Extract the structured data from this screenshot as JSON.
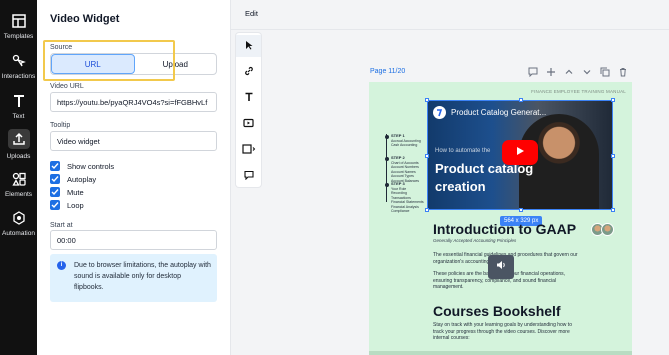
{
  "rail": {
    "items": [
      {
        "label": "Templates",
        "icon": "templates-icon"
      },
      {
        "label": "Interactions",
        "icon": "interactions-icon"
      },
      {
        "label": "Text",
        "icon": "text-icon"
      },
      {
        "label": "Uploads",
        "icon": "upload-icon"
      },
      {
        "label": "Elements",
        "icon": "elements-icon"
      },
      {
        "label": "Automation",
        "icon": "automation-icon"
      }
    ]
  },
  "panel": {
    "title": "Video Widget",
    "source_label": "Source",
    "source_options": [
      "URL",
      "Upload"
    ],
    "source_selected": "URL",
    "video_url_label": "Video URL",
    "video_url_value": "https://youtu.be/pyaQRJ4VO4s?si=fFGBHvLf",
    "tooltip_label": "Tooltip",
    "tooltip_value": "Video widget",
    "checks": [
      {
        "label": "Show controls",
        "checked": true
      },
      {
        "label": "Autoplay",
        "checked": true
      },
      {
        "label": "Mute",
        "checked": true
      },
      {
        "label": "Loop",
        "checked": true
      }
    ],
    "start_at_label": "Start at",
    "start_at_value": "00:00",
    "info_text": "Due to browser limitations, the autoplay with sound is available only for desktop flipbooks."
  },
  "editor": {
    "edit_label": "Edit",
    "page_label": "Page 11/20",
    "page_header": "FINANCE EMPLOYEE TRAINING MANUAL",
    "video": {
      "title": "Product Catalog Generat...",
      "subtitle": "How to automate the",
      "big_text": "Product catalog creation",
      "size_badge": "564 x 329 px"
    },
    "steps": [
      {
        "title": "STEP 1",
        "lines": [
          "Accrual Accounting",
          "Cash Accounting"
        ]
      },
      {
        "title": "STEP 2",
        "lines": [
          "Chart of Accounts",
          "Account Numbers",
          "Account Names",
          "Account Types",
          "Account Balances"
        ]
      },
      {
        "title": "STEP 3",
        "lines": [
          "Your Role",
          "Recording Transactions",
          "Financial Statements",
          "Financial Analysis",
          "Compliance"
        ]
      }
    ],
    "intro_heading": "Introduction to GAAP",
    "intro_sub": "Generally Accepted Accounting Principles",
    "intro_para1": "The essential financial guidelines and procedures that govern our organization's accounting activities.",
    "intro_para2": "These policies are the backbone of our financial operations, ensuring transparency, compliance, and sound financial management.",
    "course_heading": "Courses Bookshelf",
    "course_para": "Stay on track with your learning goals by understanding how to track your progress through the video courses. Discover more internal courses:"
  },
  "colors": {
    "accent": "#1d6fe3",
    "highlight": "#f2c94c",
    "page_bg": "#d4f3dc",
    "rail_bg": "#111111"
  }
}
